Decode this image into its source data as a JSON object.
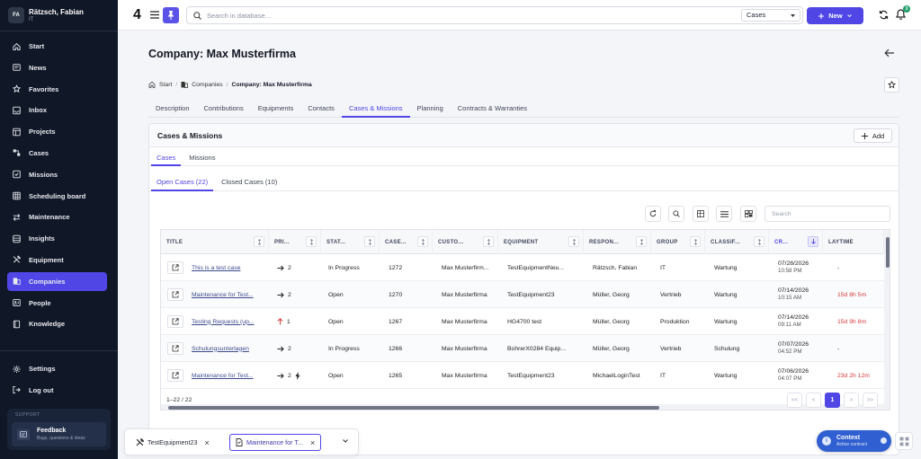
{
  "user": {
    "initials": "FA",
    "name": "Rätzsch, Fabian",
    "dept": "IT"
  },
  "nav": [
    {
      "label": "Start",
      "icon": "home-icon"
    },
    {
      "label": "News",
      "icon": "news-icon"
    },
    {
      "label": "Favorites",
      "icon": "star-icon"
    },
    {
      "label": "Inbox",
      "icon": "inbox-icon"
    },
    {
      "label": "Projects",
      "icon": "projects-icon"
    },
    {
      "label": "Cases",
      "icon": "cases-icon"
    },
    {
      "label": "Missions",
      "icon": "missions-icon"
    },
    {
      "label": "Scheduling board",
      "icon": "calendar-grid-icon"
    },
    {
      "label": "Maintenance",
      "icon": "maintenance-icon"
    },
    {
      "label": "Insights",
      "icon": "insights-icon"
    },
    {
      "label": "Equipment",
      "icon": "tools-icon"
    },
    {
      "label": "Companies",
      "icon": "building-icon",
      "active": true
    },
    {
      "label": "People",
      "icon": "people-icon"
    },
    {
      "label": "Knowledge",
      "icon": "book-icon"
    }
  ],
  "nav_bottom": [
    {
      "label": "Settings",
      "icon": "gear-icon"
    },
    {
      "label": "Log out",
      "icon": "logout-icon"
    }
  ],
  "support": {
    "label": "SUPPORT",
    "title": "Feedback",
    "subtitle": "Bugs, questions & ideas"
  },
  "topbar": {
    "logo": "4",
    "search_placeholder": "Search in database...",
    "scope": "Cases",
    "new_label": "New",
    "notification_count": "3"
  },
  "page": {
    "title": "Company: Max Musterfirma",
    "breadcrumb": [
      "Start",
      "Companies",
      "Company: Max Musterfirma"
    ]
  },
  "tabs": [
    "Description",
    "Contributions",
    "Equipments",
    "Contacts",
    "Cases & Missions",
    "Planning",
    "Contracts & Warranties"
  ],
  "active_tab": 4,
  "card": {
    "title": "Cases & Missions",
    "add_label": "Add",
    "subtabs": [
      "Cases",
      "Missions"
    ],
    "case_tabs": [
      "Open Cases (22)",
      "Closed Cases (10)"
    ],
    "search_placeholder": "Search"
  },
  "columns": [
    "TITLE",
    "PRI...",
    "STAT...",
    "CASE...",
    "CUSTO...",
    "EQUIPMENT",
    "RESPON...",
    "GROUP",
    "CLASSIF...",
    "CR...",
    "LAYTIME"
  ],
  "rows": [
    {
      "title": "This is a test case",
      "prio": "2",
      "prio_dir": "right",
      "status": "In Progress",
      "case": "1272",
      "customer": "Max Musterfirm...",
      "equipment": "TestEquipmentNeu...",
      "responsible": "Rätzsch, Fabian",
      "group": "IT",
      "class": "Wartung",
      "date": "07/28/2026",
      "time": "10:58 PM",
      "laytime": "-",
      "laytime_red": false
    },
    {
      "title": "Maintenance for Test...",
      "prio": "2",
      "prio_dir": "right",
      "status": "Open",
      "case": "1270",
      "customer": "Max Musterfirma",
      "equipment": "TestEquipment23",
      "responsible": "Müller, Georg",
      "group": "Vertrieb",
      "class": "Wartung",
      "date": "07/14/2026",
      "time": "10:15 AM",
      "laytime": "15d 8h 5m",
      "laytime_red": true
    },
    {
      "title": "Testing Requests (up...",
      "prio": "1",
      "prio_dir": "up",
      "status": "Open",
      "case": "1267",
      "customer": "Max Musterfirma",
      "equipment": "HG4700 test",
      "responsible": "Müller, Georg",
      "group": "Produktion",
      "class": "Wartung",
      "date": "07/14/2026",
      "time": "09:11 AM",
      "laytime": "15d 9h 8m",
      "laytime_red": true
    },
    {
      "title": "Schulungsunterlagen",
      "prio": "2",
      "prio_dir": "right",
      "status": "In Progress",
      "case": "1266",
      "customer": "Max Musterfirma",
      "equipment": "BohrerX0284 Equip...",
      "responsible": "Müller, Georg",
      "group": "Vertrieb",
      "class": "Schulung",
      "date": "07/07/2026",
      "time": "04:52 PM",
      "laytime": "-",
      "laytime_red": false
    },
    {
      "title": "Maintenance for Test...",
      "prio": "2",
      "prio_dir": "right",
      "urgent": true,
      "status": "Open",
      "case": "1265",
      "customer": "Max Musterfirma",
      "equipment": "TestEquipment23",
      "responsible": "MichaelLoginTest",
      "group": "IT",
      "class": "Wartung",
      "date": "07/06/2026",
      "time": "04:07 PM",
      "laytime": "23d 2h 12m",
      "laytime_red": true
    }
  ],
  "pager": {
    "info": "1–22 / 22",
    "first": "<<",
    "prev": "<",
    "current": "1",
    "next": ">",
    "last": ">>"
  },
  "dock": [
    {
      "label": "TestEquipment23",
      "icon": "tools-icon",
      "active": false
    },
    {
      "label": "Maintenance for T...",
      "icon": "document-icon",
      "active": true
    }
  ],
  "context": {
    "title": "Context",
    "subtitle": "Active contract"
  },
  "colors": {
    "accent": "#4f46e5",
    "sidebar": "#101827",
    "context": "#2f5fd0",
    "danger": "#d63b3b"
  }
}
